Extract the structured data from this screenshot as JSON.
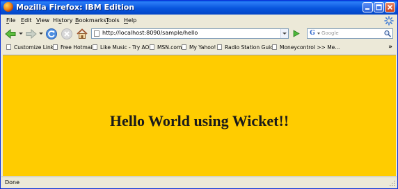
{
  "window": {
    "title": "Mozilla Firefox: IBM Edition"
  },
  "menu": [
    "File",
    "Edit",
    "View",
    "History",
    "Bookmarks",
    "Tools",
    "Help"
  ],
  "menu_mnemonics": [
    "F",
    "E",
    "V",
    "s",
    "B",
    "T",
    "H"
  ],
  "nav": {
    "url": "http://localhost:8090/sample/hello",
    "search_placeholder": "Google",
    "search_engine_letter": "G"
  },
  "bookmarks": [
    "Customize Links",
    "Free Hotmail",
    "Like Music - Try AOL!",
    "MSN.com",
    "My Yahoo!",
    "Radio Station Guide",
    "Moneycontrol >> Me..."
  ],
  "bookmarks_overflow": "»",
  "page": {
    "heading": "Hello World using Wicket!!",
    "background": "#ffcc00"
  },
  "status": {
    "text": "Done"
  },
  "colors": {
    "titlebar": "#0855dd",
    "chrome": "#ece9d8"
  },
  "icons": [
    "firefox-icon",
    "back-icon",
    "forward-icon",
    "reload-icon",
    "stop-icon",
    "home-icon",
    "go-icon",
    "search-icon",
    "page-icon",
    "bookmark-page-icon",
    "throbber-icon",
    "minimize-icon",
    "maximize-icon",
    "close-icon",
    "resize-grip-icon"
  ]
}
